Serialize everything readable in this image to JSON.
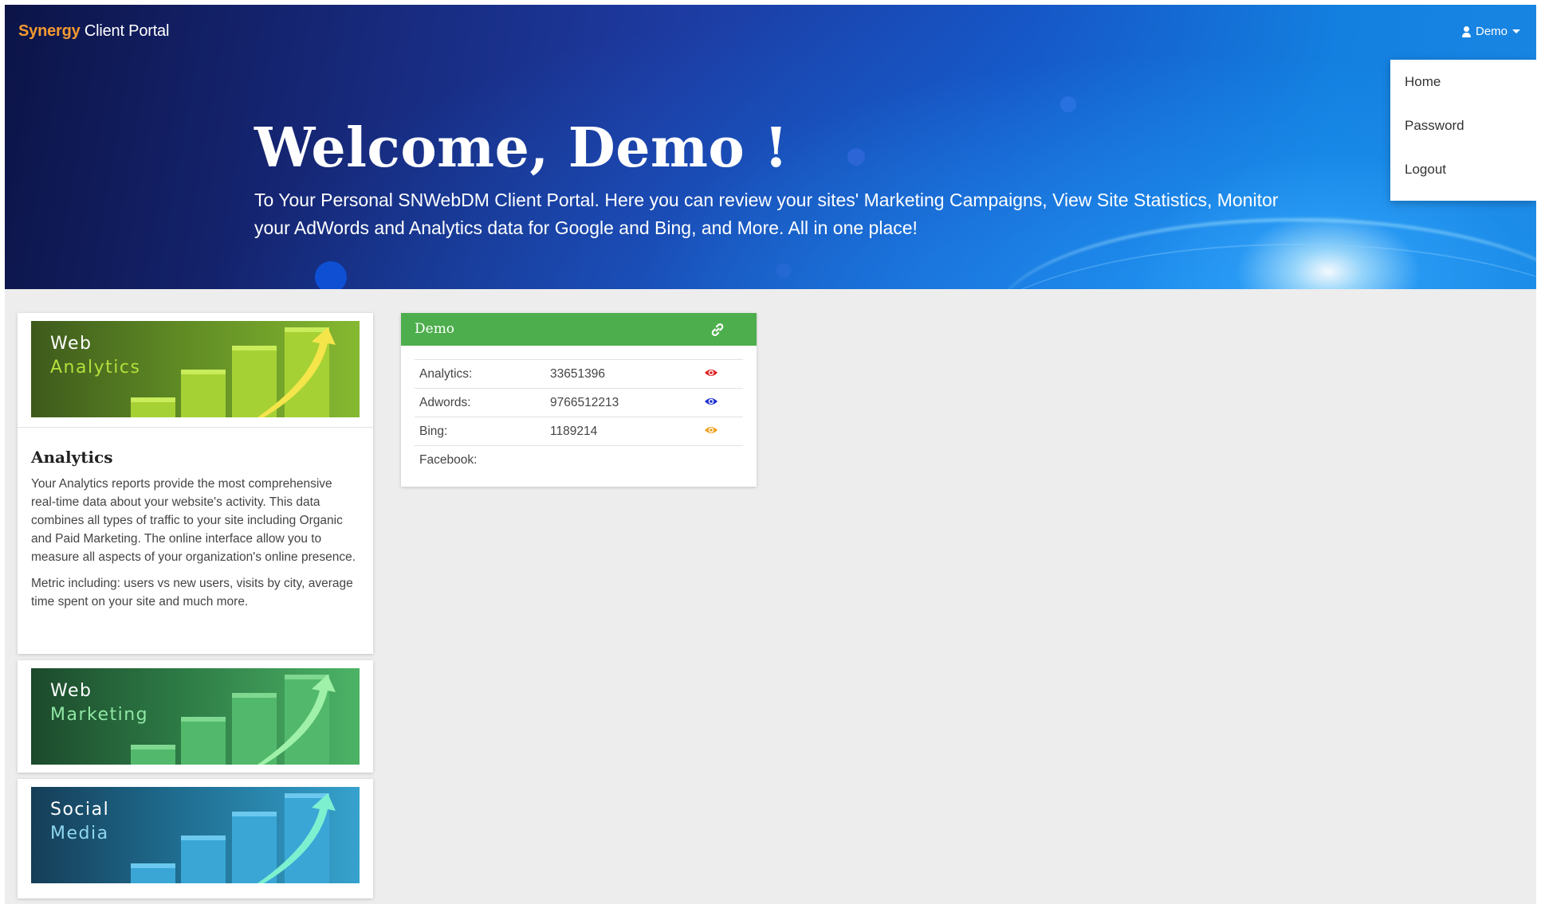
{
  "header": {
    "brand_accent": "Synergy",
    "brand_rest": "Client Portal",
    "user_label": "Demo",
    "menu": [
      "Home",
      "Password",
      "Logout"
    ]
  },
  "hero": {
    "title": "Welcome, Demo !",
    "intro": "To Your Personal SNWebDM Client Portal. Here you can review your sites' Marketing Campaigns, View Site Statistics, Monitor your AdWords and Analytics data for Google and Bing, and More. All in one place!"
  },
  "cards": {
    "analytics": {
      "banner_line1": "Web",
      "banner_line2": "Analytics",
      "heading": "Analytics",
      "paragraph1": "Your Analytics reports provide the most comprehensive real-time data about your website's activity. This data combines all types of traffic to your site including Organic and Paid Marketing. The online interface allow you to measure all aspects of your organization's online presence.",
      "paragraph2": "Metric including: users vs new users, visits by city, average time spent on your site and much more."
    },
    "marketing": {
      "banner_line1": "Web",
      "banner_line2": "Marketing"
    },
    "social": {
      "banner_line1": "Social",
      "banner_line2": "Media"
    }
  },
  "panel": {
    "title": "Demo",
    "header_color": "#4cae4c",
    "rows": [
      {
        "label": "Analytics:",
        "value": "33651396",
        "eye_color": "#e02424"
      },
      {
        "label": "Adwords:",
        "value": "9766512213",
        "eye_color": "#1f2fd0"
      },
      {
        "label": "Bing:",
        "value": "1189214",
        "eye_color": "#f0a020"
      },
      {
        "label": "Facebook:",
        "value": ""
      }
    ]
  },
  "colors": {
    "accent": "#f39a30",
    "background": "#ededed"
  }
}
